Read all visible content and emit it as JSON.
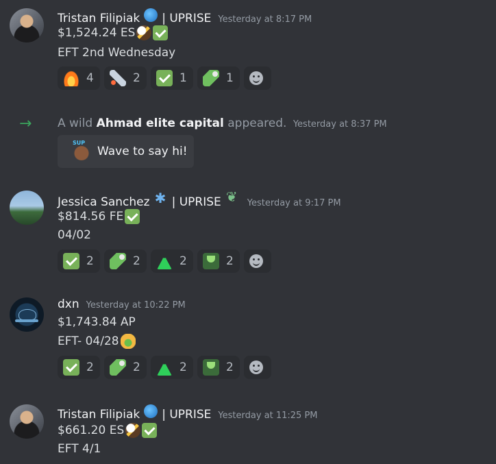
{
  "messages": [
    {
      "username": "Tristan Filipiak",
      "tag": "| UPRISE",
      "timestamp": "Yesterday at 8:17 PM",
      "line1": "$1,524.24 ES",
      "line2": "EFT 2nd Wednesday",
      "reactions": [
        {
          "icon": "fire-emoji",
          "count": "4"
        },
        {
          "icon": "rocket-emoji",
          "count": "2"
        },
        {
          "icon": "check-mark-emoji",
          "count": "1"
        },
        {
          "icon": "money-with-wings-emoji",
          "count": "1"
        }
      ]
    },
    {
      "username": "Jessica Sanchez",
      "tag": "| UPRISE",
      "timestamp": "Yesterday at 9:17 PM",
      "line1": "$814.56 FE",
      "line2": "04/02",
      "reactions": [
        {
          "icon": "check-mark-emoji",
          "count": "2"
        },
        {
          "icon": "money-with-wings-emoji",
          "count": "2"
        },
        {
          "icon": "flask-emoji",
          "count": "2"
        },
        {
          "icon": "trophy-emoji",
          "count": "2"
        }
      ]
    },
    {
      "username": "dxn",
      "timestamp": "Yesterday at 10:22 PM",
      "line1": "$1,743.84 AP",
      "line2": "EFT- 04/28",
      "reactions": [
        {
          "icon": "check-mark-emoji",
          "count": "2"
        },
        {
          "icon": "money-with-wings-emoji",
          "count": "2"
        },
        {
          "icon": "flask-emoji",
          "count": "2"
        },
        {
          "icon": "trophy-emoji",
          "count": "2"
        }
      ]
    },
    {
      "username": "Tristan Filipiak",
      "tag": "| UPRISE",
      "timestamp": "Yesterday at 11:25 PM",
      "line1": "$661.20 ES",
      "line2": "EFT 4/1"
    }
  ],
  "join": {
    "prefix": "A wild",
    "name": "Ahmad elite capital",
    "suffix": "appeared.",
    "timestamp": "Yesterday at 8:37 PM",
    "wave_label": "Wave to say hi!"
  },
  "colors": {
    "background": "#313338",
    "reaction_bg": "#2b2d31",
    "timestamp": "#949ba4",
    "join_arrow": "#3ba55d"
  }
}
